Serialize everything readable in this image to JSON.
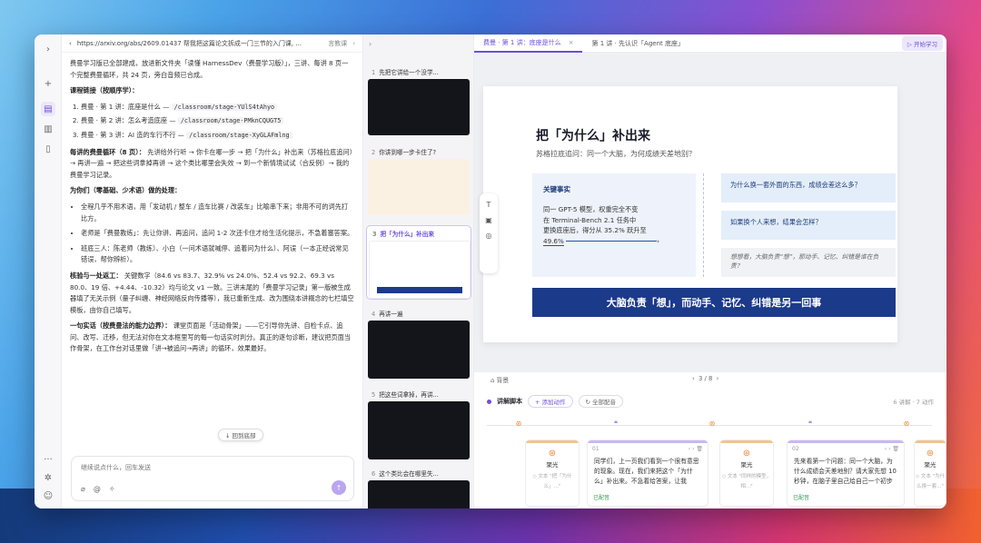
{
  "url": "https://arxiv.org/abs/2609.01437 帮我把这篇论文拆成一门三节的入门课, ...",
  "url_lang": "言教课",
  "content": {
    "intro": "费曼学习版已全部建成，放进新文件夹「读懂 HarnessDev（费曼学习版）」，三讲、每讲 8 页一个完整费曼循环，共 24 页，旁白音频已合成。",
    "links_title": "课程链接（按顺序学）：",
    "links": [
      {
        "text": "费曼 · 第 1 讲：底座是什么 —",
        "code": "/classroom/stage-YUlS4tAhyo"
      },
      {
        "text": "费曼 · 第 2 讲：怎么考造底座 —",
        "code": "/classroom/stage-PMknCQUGT5"
      },
      {
        "text": "费曼 · 第 3 讲：AI 造的车行不行 —",
        "code": "/classroom/stage-XyGLAFmlng"
      }
    ],
    "loop_title": "每讲的费曼循环（8 页）：",
    "loop_text": "先讲给外行听 → 你卡在哪一步 → 把「为什么」补出来（苏格拉底追问）→ 再讲一遍 → 把这些词拿掉再讲 → 这个类比哪里会失效 → 到一个新情境试试（合反例）→ 我的费曼学习记录。",
    "novice_title": "为你们（零基础、少术语）做的处理：",
    "bullets": [
      "全程几乎不用术语，用「发动机 / 整车 / 造车比赛 / 改装车」比喻串下来；非用不可的词先打比方。",
      "老师是「费曼教练」：先让你讲、再追问，追问 1-2 次还卡住才给生活化提示，不急着塞答案。",
      "班底三人：陈老师（教练）、小白（一问术语就喊停、追着问为什么）、阿误（一本正经说常见错误，帮你辨析）。"
    ],
    "verify_title": "核验与一处返工：",
    "verify_text": "关键数字（84.6 vs 83.7、32.9% vs 24.0%、52.4 vs 92.2、69.3 vs 80.0、19 倍、+4.44、-10.32）均与论文 v1 一致。三讲末尾的「费曼学习记录」第一版被生成器填了无关示例（量子纠缠、神经网络反向传播等），我已重新生成、改为围绕本讲概念的七栏填空模板，由你自己填写。",
    "truth_title": "一句实话（按费曼法的能力边界）：",
    "truth_text": "课堂页面是「活动骨架」——它引导你先讲、自检卡点、追问、改写、迁移，但无法对你在文本框里写的每一句话实时判分。真正的逐句诊断，建议把页面当作骨架，在工作台对话里做「讲→被追问→再讲」的循环，效果最好。"
  },
  "back_to_bottom": "回到底部",
  "input_placeholder": "继续说点什么，回车发送",
  "thumbs": [
    {
      "n": "1",
      "t": "先把它讲给一个没学..."
    },
    {
      "n": "2",
      "t": "你讲到哪一步卡住了?"
    },
    {
      "n": "3",
      "t": "把「为什么」补出来"
    },
    {
      "n": "4",
      "t": "再讲一遍"
    },
    {
      "n": "5",
      "t": "把这些词拿掉，再讲..."
    },
    {
      "n": "6",
      "t": "这个类比会在哪里失..."
    }
  ],
  "tabs": [
    {
      "label": "费曼 · 第 1 讲：底座是什么"
    },
    {
      "label": "第 1 讲 · 先认识「Agent 底座」"
    }
  ],
  "learn_button": "开始学习",
  "slide": {
    "title": "把「为什么」补出来",
    "subtitle": "苏格拉底追问：同一个大脑，为何成绩天差地别？",
    "kf_title": "关键事实",
    "kf_body_1": "同一 GPT-5 模型，权重完全不变",
    "kf_body_2": "在 Terminal-Bench 2.1 任务中",
    "kf_body_3": "更换底座后，得分从 35.2% 跃升至",
    "kf_body_4": "49.6%",
    "q1": "为什么换一套外面的东西，成绩会差这么多？",
    "q2": "如果换个人来想，结果会怎样？",
    "q3": "想想看，大脑负责“想”，那动手、记忆、纠错是谁在负责？",
    "banner": "大脑负责「想」，而动手、记忆、纠错是另一回事"
  },
  "pager": {
    "bg": "背景",
    "page": "3 / 8"
  },
  "script": {
    "title": "讲解脚本",
    "add_action": "+ 添加动作",
    "all_voice": "全部配音",
    "right": "6 讲解 · 7 动作"
  },
  "cards": [
    {
      "kind": "small",
      "label": "聚光",
      "tag": "◇ 文本 \"把「为什么」...\""
    },
    {
      "kind": "speech",
      "num": "01",
      "text": "同学们，上一页我们看到一个很有意思的现象。现在，我们来把这个「为什么」补出来。不急着给答案，让我",
      "ok": "已配音"
    },
    {
      "kind": "small",
      "label": "聚光",
      "tag": "◇ 文本 \"同样的模型，相...\""
    },
    {
      "kind": "speech",
      "num": "02",
      "text": "先来看第一个问题：同一个大脑，为什么成绩会天差地别？请大家先想 10 秒钟，在脑子里自己给自己一个初步",
      "ok": "已配音"
    },
    {
      "kind": "small",
      "label": "聚光",
      "tag": "◇ 文本 \"为什么换一套...\""
    }
  ]
}
